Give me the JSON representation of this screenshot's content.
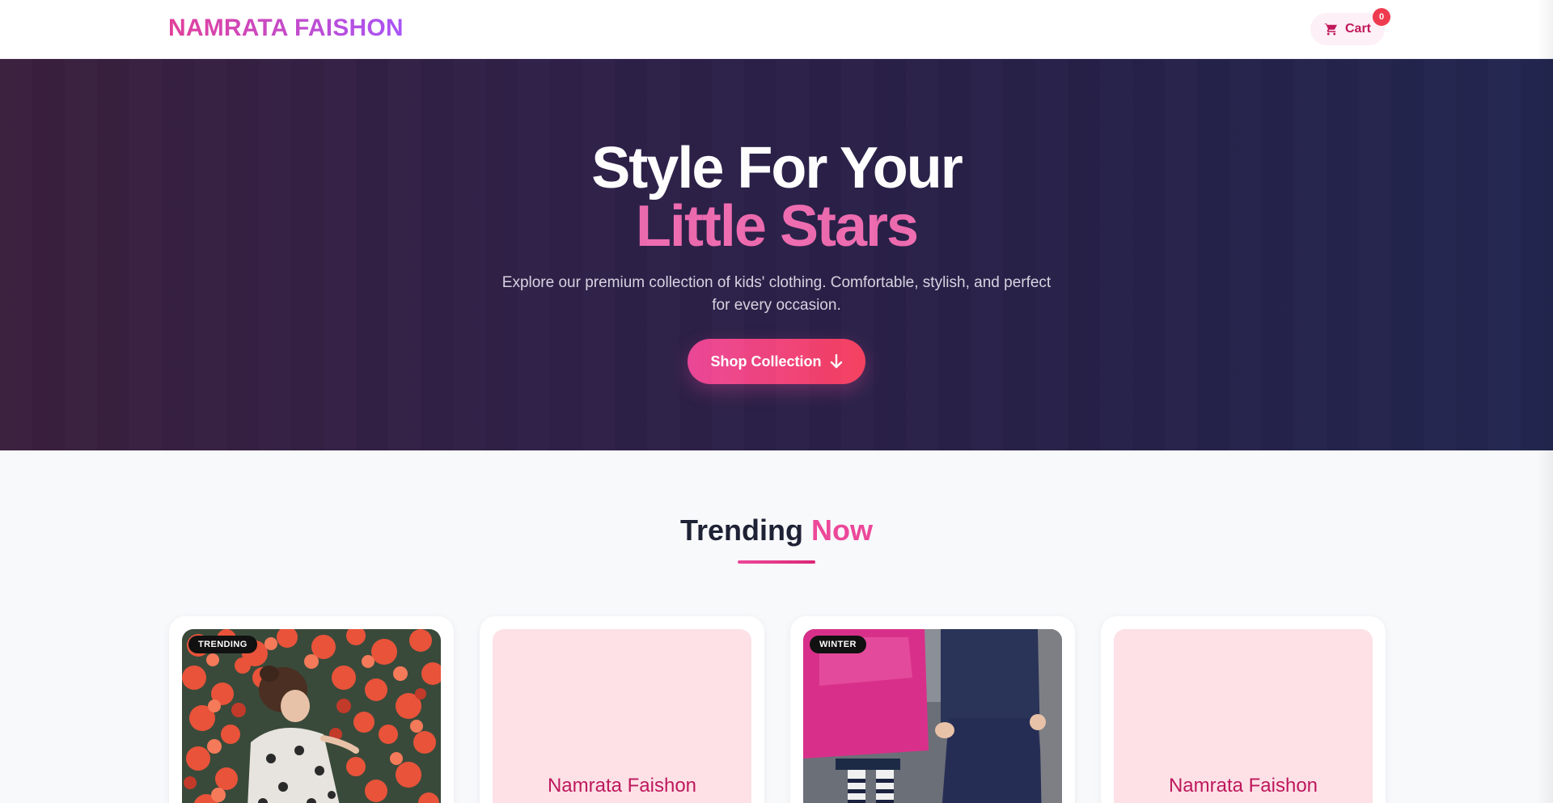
{
  "header": {
    "brand": "NAMRATA FAISHON",
    "cart_label": "Cart",
    "cart_count": "0"
  },
  "hero": {
    "title_line1": "Style For Your",
    "title_line2": "Little Stars",
    "subtitle": "Explore our premium collection of kids' clothing. Comfortable, stylish, and perfect for every occasion.",
    "cta_label": "Shop Collection"
  },
  "trending": {
    "title_main": "Trending",
    "title_accent": "Now",
    "cards": [
      {
        "badge": "TRENDING",
        "image": "girl-in-flowers-photo",
        "placeholder": ""
      },
      {
        "badge": "",
        "image": "",
        "placeholder": "Namrata Faishon"
      },
      {
        "badge": "WINTER",
        "image": "kids-winter-jackets-photo",
        "placeholder": ""
      },
      {
        "badge": "",
        "image": "",
        "placeholder": "Namrata Faishon"
      }
    ]
  },
  "colors": {
    "brand_pink": "#ec4899",
    "brand_purple": "#a855f7",
    "hero_bg": "#2b2048",
    "card_placeholder_bg": "#fde1e6"
  },
  "icons": {
    "cart": "cart-icon",
    "cta": "arrow-down-icon"
  }
}
